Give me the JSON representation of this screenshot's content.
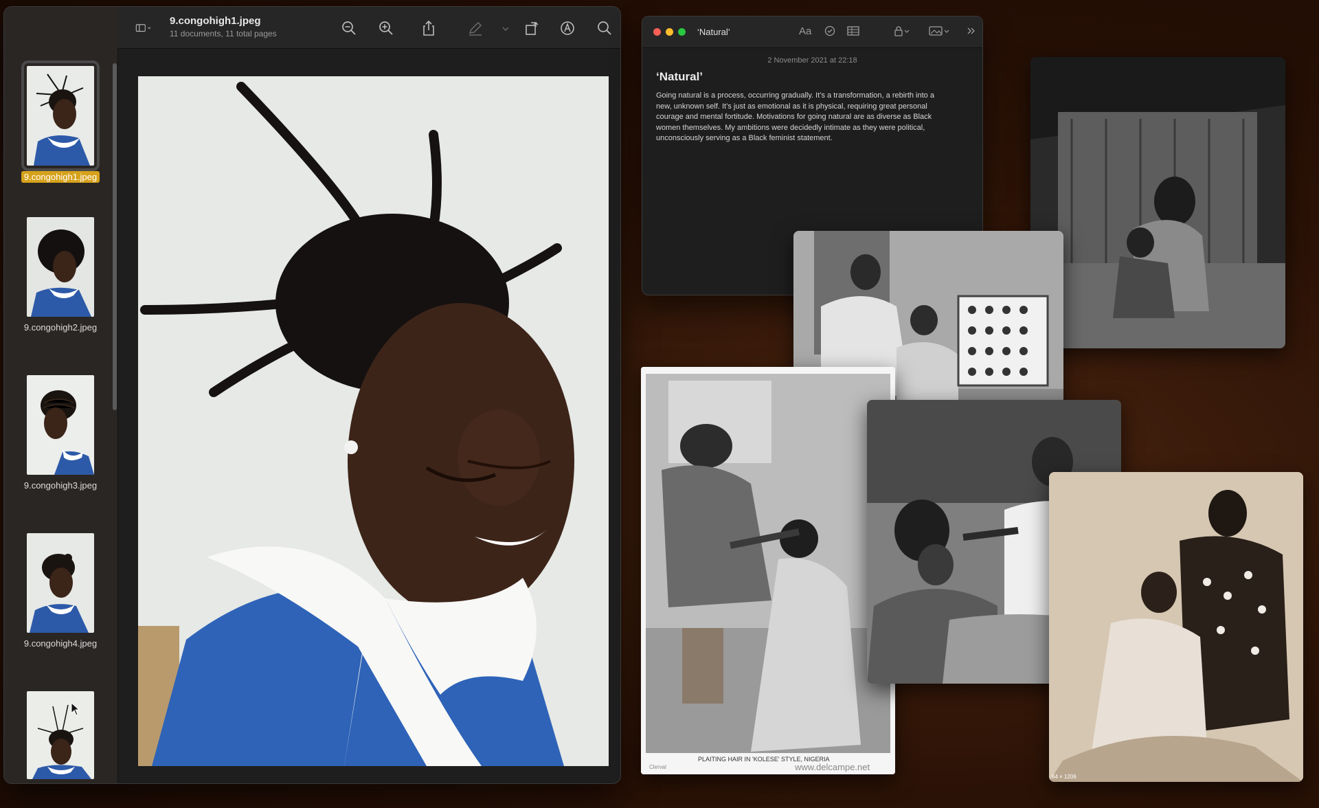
{
  "preview": {
    "title": "9.congohigh1.jpeg",
    "subtitle": "11 documents, 11 total pages",
    "thumbnails": [
      {
        "label": "9.congohigh1.jpeg"
      },
      {
        "label": "9.congohigh2.jpeg"
      },
      {
        "label": "9.congohigh3.jpeg"
      },
      {
        "label": "9.congohigh4.jpeg"
      }
    ],
    "toolbar_icons": [
      "sidebar-icon",
      "zoom-out-icon",
      "zoom-in-icon",
      "share-icon",
      "markup-pen-icon",
      "rotate-icon",
      "annotate-icon",
      "search-icon"
    ]
  },
  "notes": {
    "window_title": "‘Natural’",
    "date": "2 November 2021 at 22:18",
    "heading": "‘Natural’",
    "body": "Going natural is a process, occurring gradually. It’s a transformation, a rebirth into a new, unknown self. It’s just as emotional as it is physical, requiring great personal courage and mental fortitude. Motivations for going natural are as diverse as Black women themselves. My ambitions were decidedly intimate as they were political, unconsciously serving as a Black feminist statement.",
    "format_label": "Aa"
  },
  "photos": {
    "plaiting_caption": "PLAITING HAIR IN 'KOLESE' STYLE, NIGERIA",
    "plaiting_watermark": "www.delcampe.net",
    "plaiting_credit": "Clerval",
    "sepia_dims": "64 × 1206"
  }
}
